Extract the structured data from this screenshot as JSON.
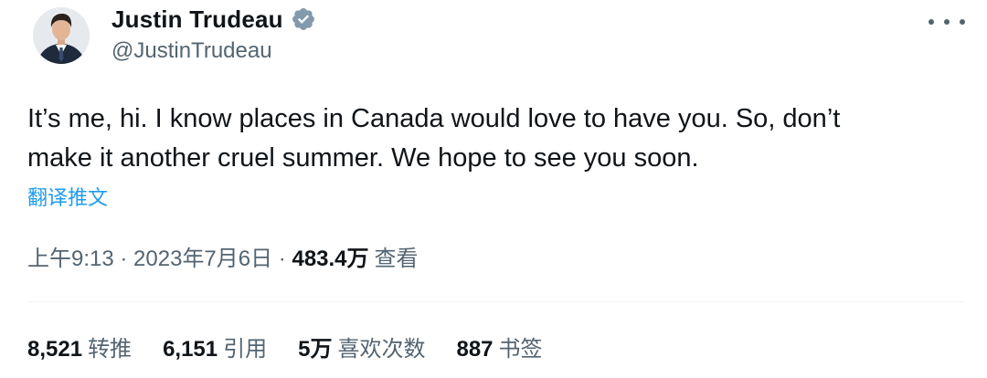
{
  "author": {
    "display_name": "Justin Trudeau",
    "handle": "@JustinTrudeau",
    "verified_icon": "verified-badge-icon",
    "avatar_icon": "avatar"
  },
  "tweet": {
    "text": "It’s me, hi. I know places in Canada would love to have you. So, don’t\nmake it another cruel summer. We hope to see you soon.",
    "translate_label": "翻译推文"
  },
  "meta": {
    "time": "上午9:13",
    "separator1": " · ",
    "date": "2023年7月6日",
    "separator2": " · ",
    "views_count": "483.4万",
    "views_label": "查看"
  },
  "stats": [
    {
      "count": "8,521",
      "label": "转推"
    },
    {
      "count": "6,151",
      "label": "引用"
    },
    {
      "count": "5万",
      "label": "喜欢次数"
    },
    {
      "count": "887",
      "label": "书签"
    }
  ],
  "colors": {
    "text_primary": "#0f1419",
    "text_secondary": "#536471",
    "link_blue": "#1d9bf0",
    "verified_gray": "#829aab"
  }
}
